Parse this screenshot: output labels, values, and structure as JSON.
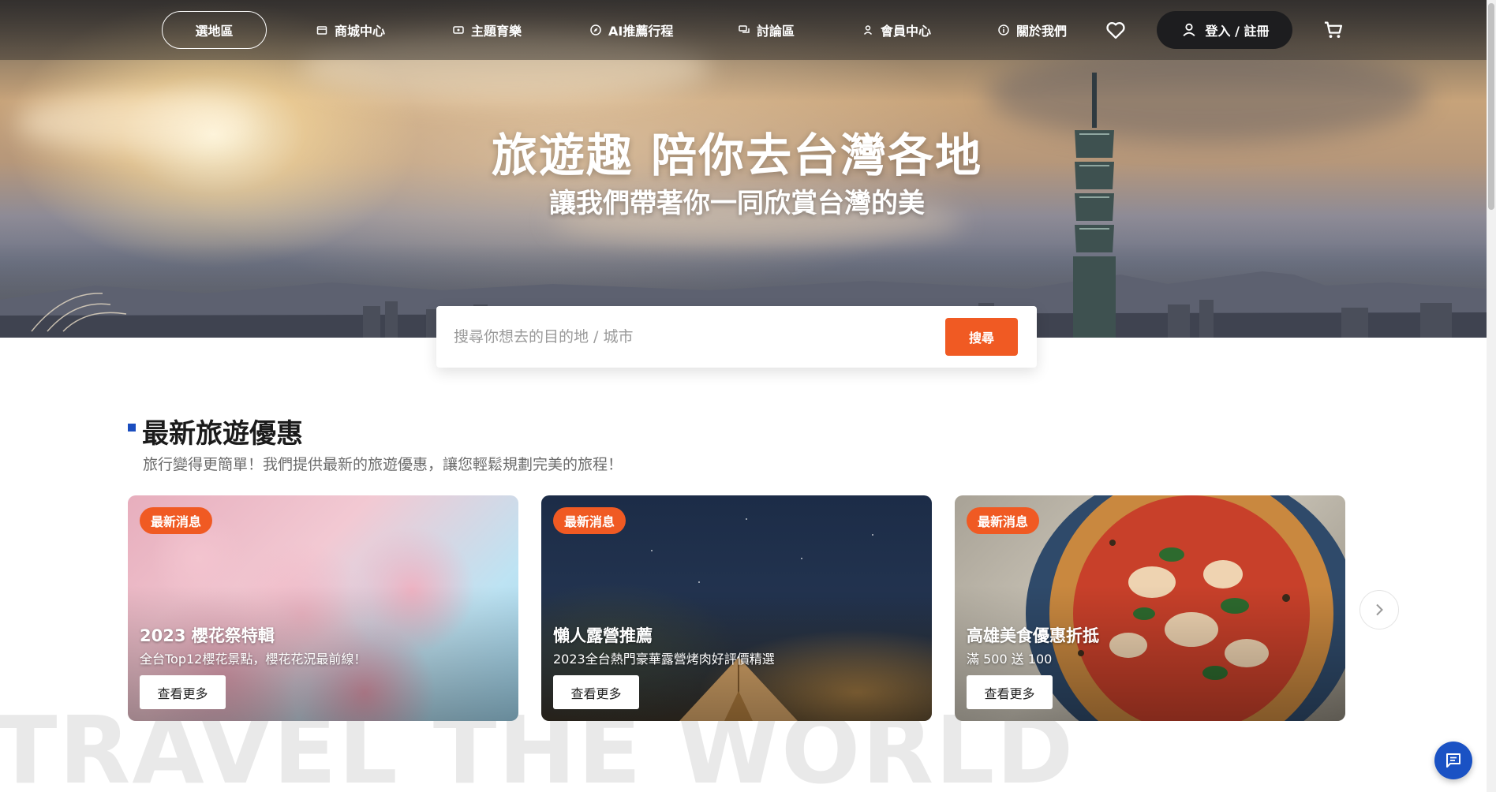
{
  "nav": {
    "region_label": "選地區",
    "items": [
      {
        "label": "商城中心",
        "icon": "store-icon"
      },
      {
        "label": "主題育樂",
        "icon": "ticket-icon"
      },
      {
        "label": "AI推薦行程",
        "icon": "compass-icon"
      },
      {
        "label": "討論區",
        "icon": "chat-bubbles-icon"
      },
      {
        "label": "會員中心",
        "icon": "user-icon"
      },
      {
        "label": "關於我們",
        "icon": "info-icon"
      }
    ],
    "login_label": "登入 / 註冊"
  },
  "hero": {
    "title": "旅遊趣  陪你去台灣各地",
    "subtitle": "讓我們帶著你一同欣賞台灣的美"
  },
  "search": {
    "placeholder": "搜尋你想去的目的地 / 城市",
    "button_label": "搜尋"
  },
  "section": {
    "title": "最新旅遊優惠",
    "description": "旅行變得更簡單！我們提供最新的旅遊優惠，讓您輕鬆規劃完美的旅程！",
    "cards": [
      {
        "badge": "最新消息",
        "title": "2023 櫻花祭特輯",
        "subtitle": "全台Top12櫻花景點，櫻花花況最前線！",
        "button": "查看更多",
        "image": "cherry-blossom"
      },
      {
        "badge": "最新消息",
        "title": "懶人露營推薦",
        "subtitle": "2023全台熱門豪華露營烤肉好評價精選",
        "button": "查看更多",
        "image": "night-camping-tent"
      },
      {
        "badge": "最新消息",
        "title": "高雄美食優惠折抵",
        "subtitle": "滿 500 送 100",
        "button": "查看更多",
        "image": "pizza"
      }
    ]
  },
  "watermark": "TRAVEL THE WORLD",
  "colors": {
    "accent": "#f05a23",
    "brand_blue": "#1a52c4",
    "nav_dark": "#1d1d1f"
  }
}
